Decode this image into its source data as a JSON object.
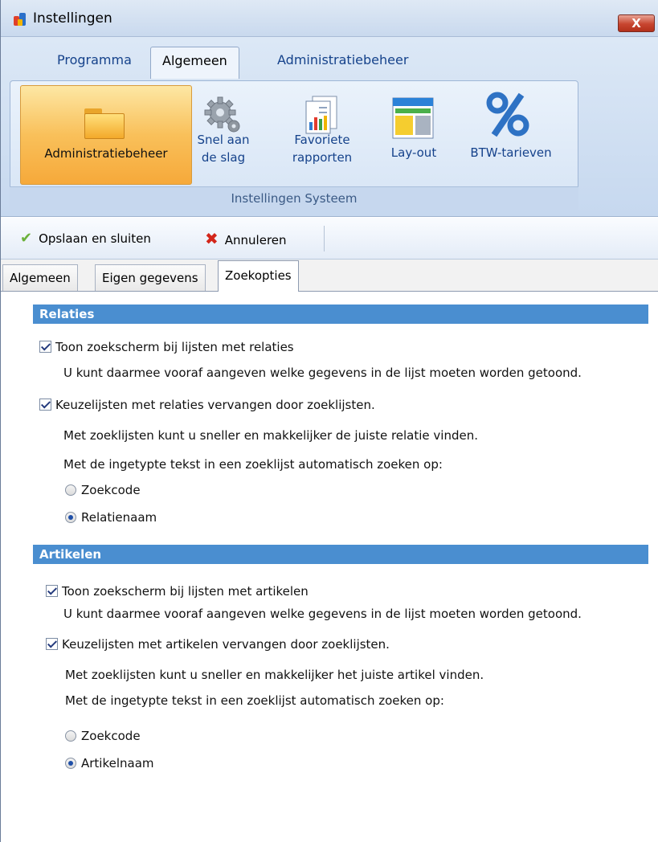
{
  "window": {
    "title": "Instellingen",
    "close_label": "X"
  },
  "ribbon": {
    "tabs": [
      {
        "label": "Programma"
      },
      {
        "label": "Algemeen"
      },
      {
        "label": "Administratiebeheer"
      }
    ],
    "buttons": [
      {
        "label": "Administratiebeheer",
        "icon": "folder-icon"
      },
      {
        "label_line1": "Snel aan",
        "label_line2": "de slag",
        "icon": "gear-icon"
      },
      {
        "label_line1": "Favoriete",
        "label_line2": "rapporten",
        "icon": "report-icon"
      },
      {
        "label": "Lay-out",
        "icon": "layout-icon"
      },
      {
        "label": "BTW-tarieven",
        "icon": "percent-icon"
      }
    ],
    "group_label": "Instellingen Systeem"
  },
  "toolbar": {
    "save_label": "Opslaan en sluiten",
    "cancel_label": "Annuleren"
  },
  "subtabs": [
    {
      "label": "Algemeen"
    },
    {
      "label": "Eigen gegevens"
    },
    {
      "label": "Zoekopties"
    }
  ],
  "sections": {
    "relaties": {
      "header": "Relaties",
      "opt1_label": "Toon zoekscherm bij lijsten met relaties",
      "opt1_desc": "U kunt daarmee vooraf aangeven welke gegevens in de lijst moeten worden getoond.",
      "opt2_label": "Keuzelijsten met relaties vervangen door zoeklijsten.",
      "opt2_desc1": "Met zoeklijsten kunt u sneller en makkelijker de juiste relatie vinden.",
      "opt2_desc2": "Met de ingetypte tekst in een zoeklijst automatisch zoeken op:",
      "radio1": "Zoekcode",
      "radio2": "Relatienaam",
      "opt1_checked": true,
      "opt2_checked": true,
      "selected_radio": "Relatienaam"
    },
    "artikelen": {
      "header": "Artikelen",
      "opt1_label": "Toon zoekscherm bij lijsten met artikelen",
      "opt1_desc": "U kunt daarmee vooraf aangeven welke gegevens in de lijst moeten worden getoond.",
      "opt2_label": "Keuzelijsten met artikelen vervangen door zoeklijsten.",
      "opt2_desc1": "Met zoeklijsten kunt u sneller en makkelijker het juiste artikel vinden.",
      "opt2_desc2": "Met de ingetypte tekst in een zoeklijst automatisch zoeken op:",
      "radio1": "Zoekcode",
      "radio2": "Artikelnaam",
      "opt1_checked": true,
      "opt2_checked": true,
      "selected_radio": "Artikelnaam"
    }
  },
  "colors": {
    "section_header": "#4a8ed0",
    "active_ribbon_button": "#f9c05a",
    "close_button": "#c7452f"
  }
}
